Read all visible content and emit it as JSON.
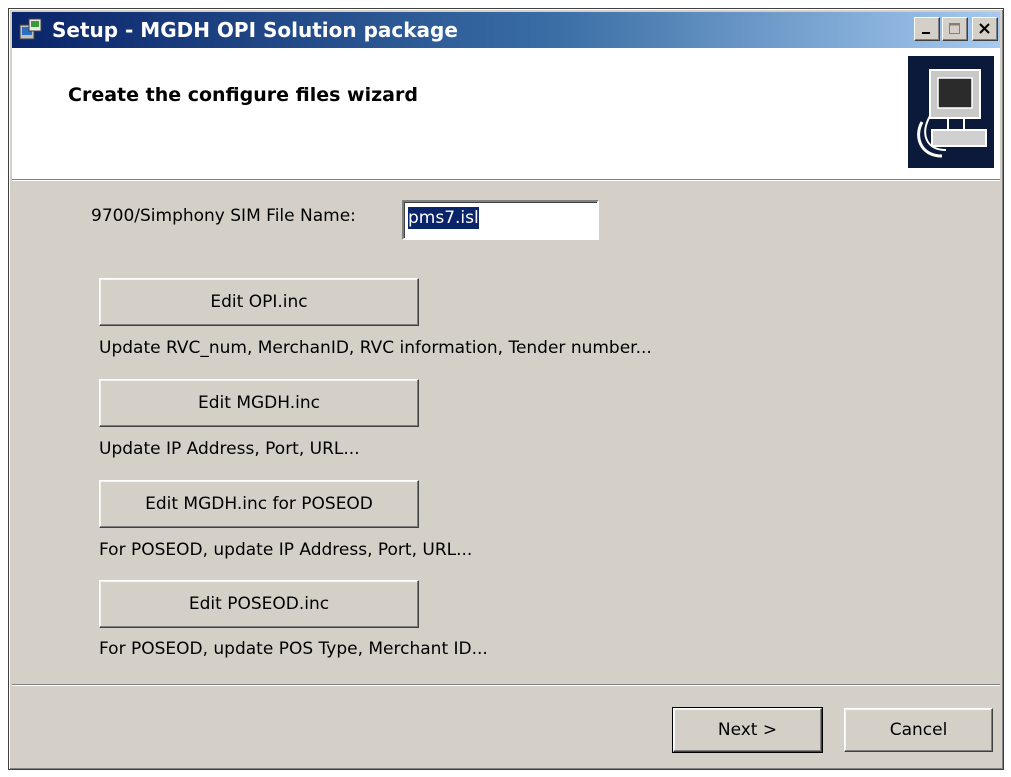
{
  "window": {
    "title": "Setup - MGDH OPI Solution package"
  },
  "header": {
    "title": "Create the configure files wizard",
    "image_icon": "computer-setup-icon"
  },
  "sim": {
    "label": "9700/Simphony SIM File Name:",
    "value": "pms7.isl"
  },
  "actions": [
    {
      "button": "Edit OPI.inc",
      "description": "Update RVC_num, MerchanID, RVC information, Tender number..."
    },
    {
      "button": "Edit MGDH.inc",
      "description": "Update IP Address, Port, URL..."
    },
    {
      "button": "Edit MGDH.inc for POSEOD",
      "description": "For POSEOD, update IP Address, Port, URL..."
    },
    {
      "button": "Edit POSEOD.inc",
      "description": "For POSEOD, update POS Type, Merchant ID..."
    }
  ],
  "footer": {
    "next_label": "Next >",
    "cancel_label": "Cancel"
  },
  "icons": {
    "app": "setup-icon",
    "minimize": "minimize-icon",
    "maximize": "maximize-icon",
    "close": "close-icon"
  }
}
